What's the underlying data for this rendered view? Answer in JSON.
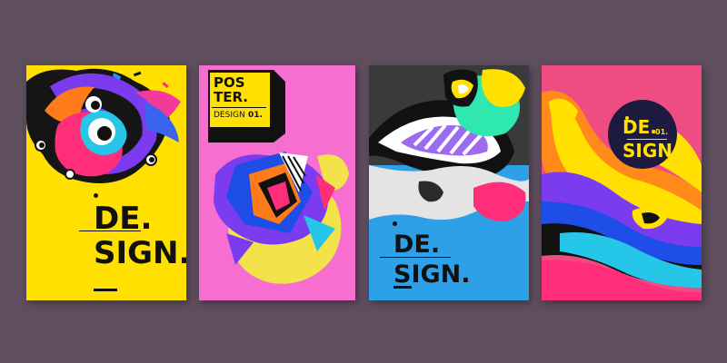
{
  "colors": {
    "background": "#5e4e5e",
    "poster1_bg": "#ffe000",
    "poster2_bg": "#f66ed0",
    "poster3_bg": "#2ea0e8",
    "poster4_bg": "#ef4c83",
    "ink": "#111111"
  },
  "posters": [
    {
      "line1": "DE.",
      "line2": "SIGN."
    },
    {
      "box_line1": "POS",
      "box_line2": "TER.",
      "box_line3": "DESIGN",
      "box_number": "01."
    },
    {
      "line1": "DE.",
      "line2": "SIGN."
    },
    {
      "line1": "DE.",
      "number": "01.",
      "line2": "SIGN"
    }
  ]
}
